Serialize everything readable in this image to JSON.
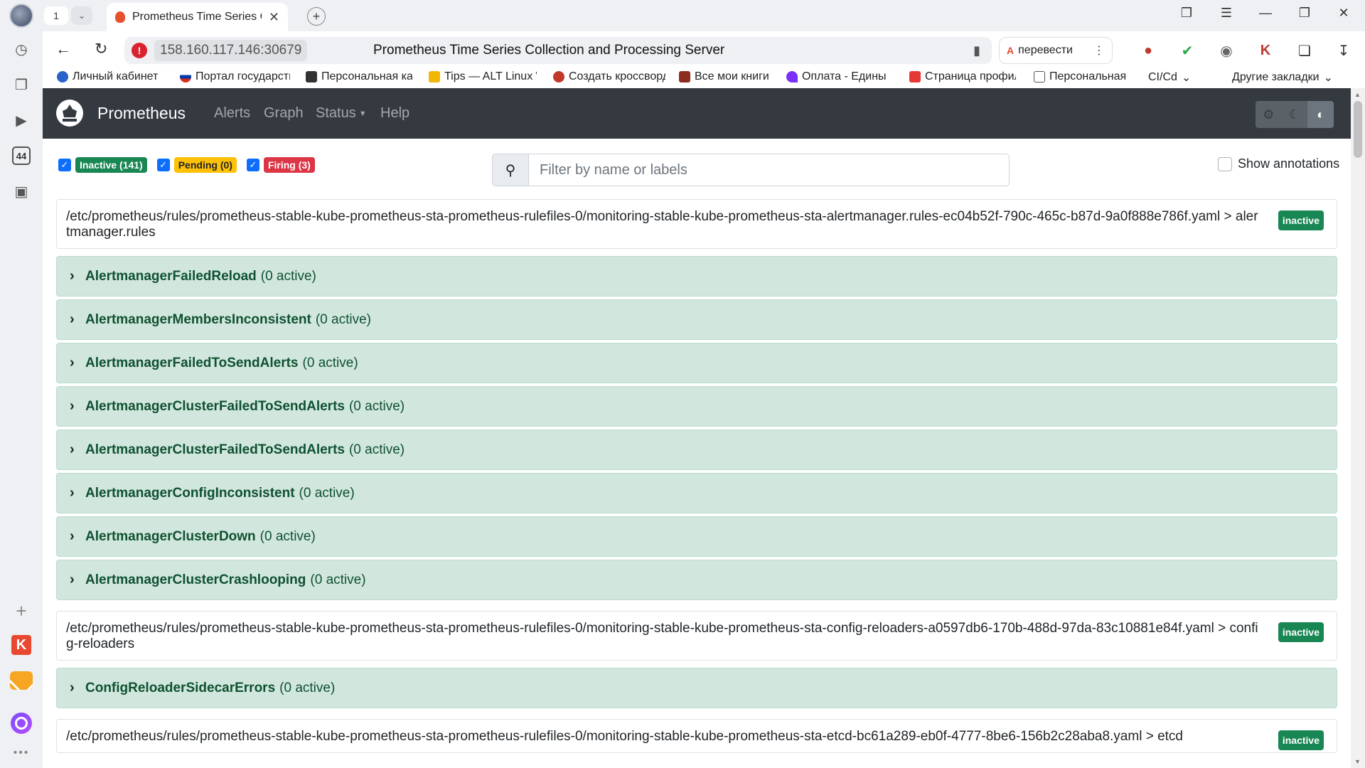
{
  "browser": {
    "tab_count": "1",
    "tab_title": "Prometheus Time Series Collection and Processing Server",
    "host": "158.160.117.146:30679",
    "page_title": "Prometheus Time Series Collection and Processing Server",
    "translate_label": "перевести",
    "sidebar_counter": "44",
    "bookmarks": [
      {
        "label": "Личный кабинет",
        "color": "#2a62c9"
      },
      {
        "label": "Портал государственных",
        "color": "#d52b1e"
      },
      {
        "label": "Персональная карта",
        "color": "#333333"
      },
      {
        "label": "Tips — ALT Linux Wiki",
        "color": "#f2b705"
      },
      {
        "label": "Создать кроссворд",
        "color": "#c0392b"
      },
      {
        "label": "Все мои книги",
        "color": "#8b2d1f"
      },
      {
        "label": "Оплата - Единый",
        "color": "#7b2ff7"
      },
      {
        "label": "Страница профиля",
        "color": "#e53935"
      },
      {
        "label": "Персональная",
        "color": "#555555"
      },
      {
        "label": "CI/Cd",
        "color": ""
      }
    ],
    "other_bookmarks": "Другие закладки"
  },
  "nav": {
    "brand": "Prometheus",
    "links": [
      "Alerts",
      "Graph",
      "Status",
      "Help"
    ]
  },
  "filters": {
    "inactive": "Inactive (141)",
    "pending": "Pending (0)",
    "firing": "Firing (3)"
  },
  "search": {
    "placeholder": "Filter by name or labels"
  },
  "show_annotations": "Show annotations",
  "groups": [
    {
      "path": "/etc/prometheus/rules/prometheus-stable-kube-prometheus-sta-prometheus-rulefiles-0/monitoring-stable-kube-prometheus-sta-alertmanager.rules-ec04b52f-790c-465c-b87d-9a0f888e786f.yaml > alertmanager.rules",
      "state": "inactive",
      "rules": [
        {
          "name": "AlertmanagerFailedReload",
          "active": "(0 active)"
        },
        {
          "name": "AlertmanagerMembersInconsistent",
          "active": "(0 active)"
        },
        {
          "name": "AlertmanagerFailedToSendAlerts",
          "active": "(0 active)"
        },
        {
          "name": "AlertmanagerClusterFailedToSendAlerts",
          "active": "(0 active)"
        },
        {
          "name": "AlertmanagerClusterFailedToSendAlerts",
          "active": "(0 active)"
        },
        {
          "name": "AlertmanagerConfigInconsistent",
          "active": "(0 active)"
        },
        {
          "name": "AlertmanagerClusterDown",
          "active": "(0 active)"
        },
        {
          "name": "AlertmanagerClusterCrashlooping",
          "active": "(0 active)"
        }
      ]
    },
    {
      "path": "/etc/prometheus/rules/prometheus-stable-kube-prometheus-sta-prometheus-rulefiles-0/monitoring-stable-kube-prometheus-sta-config-reloaders-a0597db6-170b-488d-97da-83c10881e84f.yaml > config-reloaders",
      "state": "inactive",
      "rules": [
        {
          "name": "ConfigReloaderSidecarErrors",
          "active": "(0 active)"
        }
      ]
    },
    {
      "path": "/etc/prometheus/rules/prometheus-stable-kube-prometheus-sta-prometheus-rulefiles-0/monitoring-stable-kube-prometheus-sta-etcd-bc61a289-eb0f-4777-8be6-156b2c28aba8.yaml > etcd",
      "state": "inactive",
      "rules": []
    }
  ]
}
